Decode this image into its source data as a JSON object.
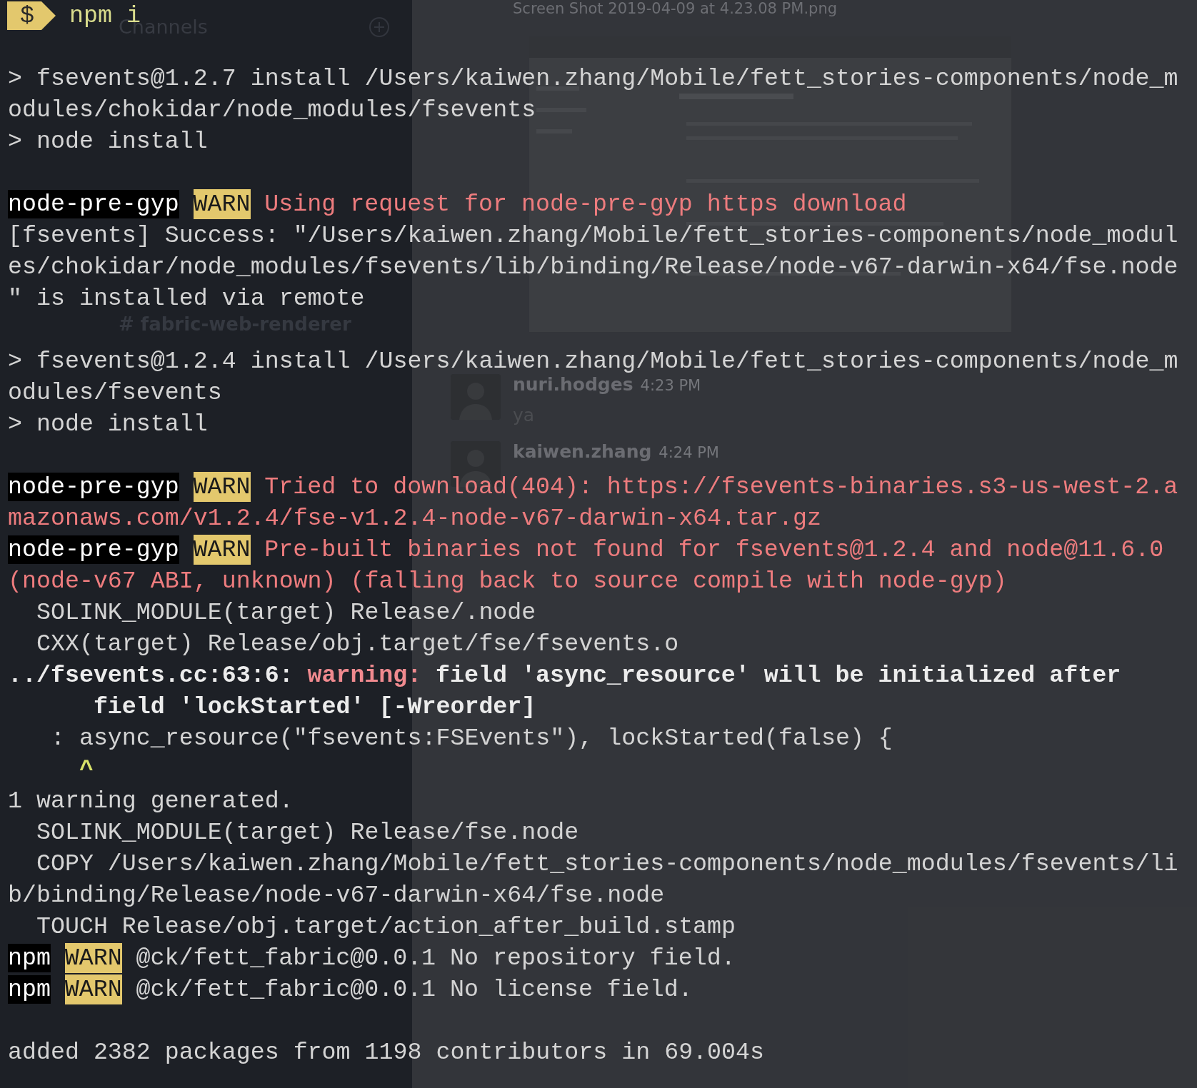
{
  "slack": {
    "sidebar": {
      "heading": "Channels",
      "channels": [
        {
          "name": "# fabric-web-renderer"
        }
      ]
    },
    "attachment": {
      "filename": "Screen Shot 2019-04-09 at 4.23.08 PM.png"
    },
    "messages": [
      {
        "author": "nuri.hodges",
        "time": "4:23 PM",
        "text": "ya"
      },
      {
        "author": "kaiwen.zhang",
        "time": "4:24 PM"
      }
    ]
  },
  "terminal": {
    "rows": [
      {
        "segments": [
          {
            "kind": "prompt",
            "text": "$"
          },
          {
            "kind": "command",
            "text": "npm i"
          }
        ]
      },
      {
        "spaced": true,
        "segments": [
          {
            "kind": "text",
            "text": "> fsevents@1.2.7 install /Users/kaiwen.zhang/Mobile/fett_stories-components/node_m"
          }
        ]
      },
      {
        "segments": [
          {
            "kind": "text",
            "text": "odules/chokidar/node_modules/fsevents"
          }
        ]
      },
      {
        "segments": [
          {
            "kind": "text",
            "text": "> node install"
          }
        ]
      },
      {
        "spaced": true,
        "segments": [
          {
            "kind": "prefix",
            "text": "node-pre-gyp"
          },
          {
            "kind": "warn",
            "text": "WARN"
          },
          {
            "kind": "error",
            "text": "Using request for node-pre-gyp https download"
          }
        ]
      },
      {
        "segments": [
          {
            "kind": "text",
            "text": "[fsevents] Success: \"/Users/kaiwen.zhang/Mobile/fett_stories-components/node_modul"
          }
        ]
      },
      {
        "segments": [
          {
            "kind": "text",
            "text": "es/chokidar/node_modules/fsevents/lib/binding/Release/node-v67-darwin-x64/fse.node"
          }
        ]
      },
      {
        "segments": [
          {
            "kind": "text",
            "text": "\" is installed via remote"
          }
        ]
      },
      {
        "spaced": true,
        "segments": [
          {
            "kind": "text",
            "text": "> fsevents@1.2.4 install /Users/kaiwen.zhang/Mobile/fett_stories-components/node_m"
          }
        ]
      },
      {
        "segments": [
          {
            "kind": "text",
            "text": "odules/fsevents"
          }
        ]
      },
      {
        "segments": [
          {
            "kind": "text",
            "text": "> node install"
          }
        ]
      },
      {
        "spaced": true,
        "segments": [
          {
            "kind": "prefix",
            "text": "node-pre-gyp"
          },
          {
            "kind": "warn",
            "text": "WARN"
          },
          {
            "kind": "error",
            "text": "Tried to download(404): https://fsevents-binaries.s3-us-west-2.a"
          }
        ]
      },
      {
        "segments": [
          {
            "kind": "error",
            "text": "mazonaws.com/v1.2.4/fse-v1.2.4-node-v67-darwin-x64.tar.gz"
          }
        ]
      },
      {
        "segments": [
          {
            "kind": "prefix",
            "text": "node-pre-gyp"
          },
          {
            "kind": "warn",
            "text": "WARN"
          },
          {
            "kind": "error",
            "text": "Pre-built binaries not found for fsevents@1.2.4 and node@11.6.0"
          }
        ]
      },
      {
        "segments": [
          {
            "kind": "error",
            "text": "(node-v67 ABI, unknown) (falling back to source compile with node-gyp)"
          }
        ]
      },
      {
        "segments": [
          {
            "kind": "text",
            "text": "  SOLINK_MODULE(target) Release/.node"
          }
        ]
      },
      {
        "segments": [
          {
            "kind": "text",
            "text": "  CXX(target) Release/obj.target/fse/fsevents.o"
          }
        ]
      },
      {
        "segments": [
          {
            "kind": "bold",
            "text": "../fsevents.cc:63:6:"
          },
          {
            "kind": "alert",
            "text": "warning:"
          },
          {
            "kind": "bold",
            "text": "field 'async_resource' will be initialized after"
          }
        ]
      },
      {
        "segments": [
          {
            "kind": "bold",
            "text": "      field 'lockStarted' [-Wreorder]"
          }
        ]
      },
      {
        "segments": [
          {
            "kind": "text",
            "text": "   : async_resource(\"fsevents:FSEvents\"), lockStarted(false) {"
          }
        ]
      },
      {
        "segments": [
          {
            "kind": "caret",
            "text": "     ^"
          }
        ]
      },
      {
        "segments": [
          {
            "kind": "text",
            "text": "1 warning generated."
          }
        ]
      },
      {
        "segments": [
          {
            "kind": "text",
            "text": "  SOLINK_MODULE(target) Release/fse.node"
          }
        ]
      },
      {
        "segments": [
          {
            "kind": "text",
            "text": "  COPY /Users/kaiwen.zhang/Mobile/fett_stories-components/node_modules/fsevents/li"
          }
        ]
      },
      {
        "segments": [
          {
            "kind": "text",
            "text": "b/binding/Release/node-v67-darwin-x64/fse.node"
          }
        ]
      },
      {
        "segments": [
          {
            "kind": "text",
            "text": "  TOUCH Release/obj.target/action_after_build.stamp"
          }
        ]
      },
      {
        "segments": [
          {
            "kind": "prefix",
            "text": "npm"
          },
          {
            "kind": "warn",
            "text": "WARN"
          },
          {
            "kind": "text",
            "text": "@ck/fett_fabric@0.0.1 No repository field."
          }
        ]
      },
      {
        "segments": [
          {
            "kind": "prefix",
            "text": "npm"
          },
          {
            "kind": "warn",
            "text": "WARN"
          },
          {
            "kind": "text",
            "text": "@ck/fett_fabric@0.0.1 No license field."
          }
        ]
      },
      {
        "spaced": true,
        "segments": [
          {
            "kind": "text",
            "text": "added 2382 packages from 1198 contributors in 69.004s"
          }
        ]
      }
    ]
  }
}
